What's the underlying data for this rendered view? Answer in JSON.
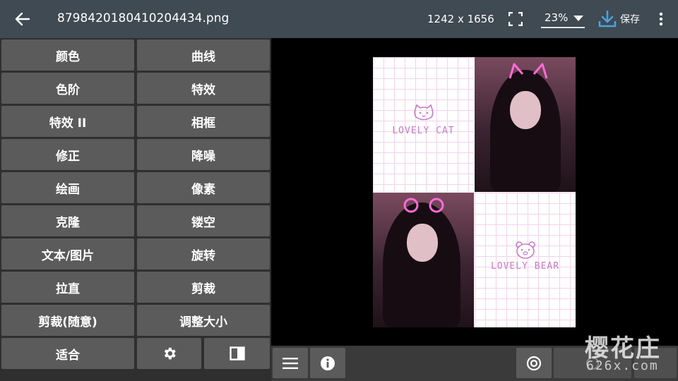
{
  "topbar": {
    "filename": "8798420180410204434.png",
    "dimensions": "1242 x 1656",
    "zoom": "23%",
    "save_label": "保存",
    "icons": [
      "arrow-back-icon",
      "fullscreen-icon",
      "chevron-down-icon",
      "download-icon",
      "more-vert-icon"
    ]
  },
  "tools": {
    "color": "颜色",
    "curves": "曲线",
    "levels": "色阶",
    "effects": "特效",
    "effects2": "特效 II",
    "frame": "相框",
    "correct": "修正",
    "denoise": "降噪",
    "draw": "绘画",
    "pixel": "像素",
    "clone": "克隆",
    "hollow": "镂空",
    "text_image": "文本/图片",
    "rotate": "旋转",
    "straighten": "拉直",
    "crop": "剪裁",
    "crop_free": "剪裁(随意)",
    "resize": "调整大小",
    "fit": "适合"
  },
  "image": {
    "panel1_text": "LOVELY CAT",
    "panel4_text": "LOVELY BEAR"
  },
  "bottombar": {
    "icons": [
      "menu-icon",
      "info-icon",
      "target-icon",
      "compare-icon"
    ]
  },
  "watermark": {
    "main": "樱花庄",
    "sub": "626x.com"
  },
  "colors": {
    "topbar": "#3f4a52",
    "button": "#5b5b5b",
    "accent": "#4aa3df"
  }
}
